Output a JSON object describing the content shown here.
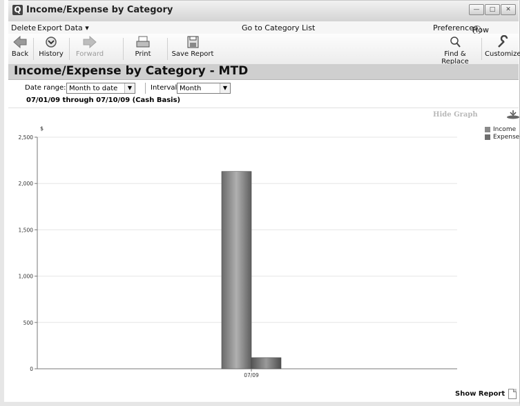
{
  "window": {
    "title": "Income/Expense by Category",
    "controls": {
      "minimize": "—",
      "maximize": "□",
      "close": "✕"
    }
  },
  "menubar": {
    "delete": "Delete",
    "export_data": "Export Data ▾",
    "go_to_category_list": "Go to Category List",
    "preferences": "Preferences",
    "how_do_i": "How Do I?",
    "help_icon": "?"
  },
  "toolbar": {
    "back": "Back",
    "history": "History",
    "forward": "Forward",
    "print": "Print",
    "save_report": "Save Report",
    "find_replace": "Find & Replace",
    "customize": "Customize"
  },
  "report": {
    "title": "Income/Expense by Category - MTD",
    "date_range_label": "Date range:",
    "date_range_value": "Month to date",
    "interval_label": "Interval:",
    "interval_value": "Month",
    "range_text": "07/01/09 through 07/10/09 (Cash Basis)"
  },
  "graph": {
    "hide_graph": "Hide Graph",
    "show_report": "Show Report"
  },
  "colors": {
    "income": "#8a8a8a",
    "expense": "#6e6e6e"
  },
  "chart_data": {
    "type": "bar",
    "categories": [
      "07/09"
    ],
    "series": [
      {
        "name": "Income",
        "values": [
          2130
        ]
      },
      {
        "name": "Expense",
        "values": [
          120
        ]
      }
    ],
    "ylabel": "$",
    "ylim": [
      0,
      2500
    ],
    "yticks": [
      0,
      500,
      1000,
      1500,
      2000,
      2500
    ],
    "ytick_labels": [
      "0",
      "500",
      "1,000",
      "1,500",
      "2,000",
      "2,500"
    ],
    "legend": "top-right",
    "grid": true
  }
}
